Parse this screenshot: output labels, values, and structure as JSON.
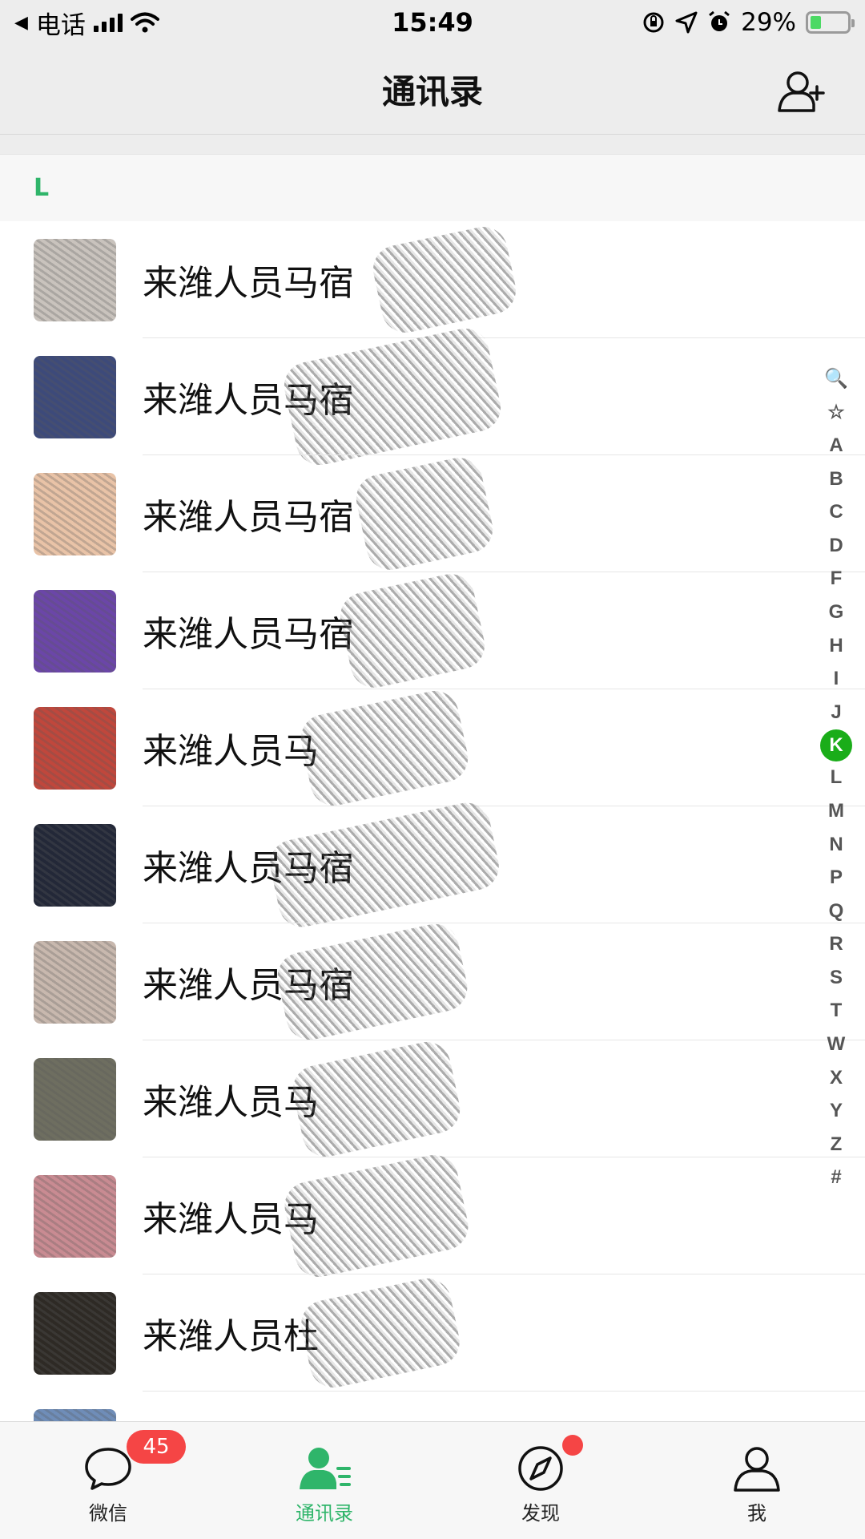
{
  "status_bar": {
    "back_label": "电话",
    "time": "15:49",
    "battery_percent": "29%",
    "battery_level": 0.29
  },
  "nav": {
    "title": "通讯录"
  },
  "section": {
    "letter": "L"
  },
  "contacts": [
    {
      "name": "来潍人员马宿",
      "avatar_color": "#c9c3bd"
    },
    {
      "name": "来潍人员马宿",
      "avatar_color": "#3d4a7a"
    },
    {
      "name": "来潍人员马宿",
      "avatar_color": "#e9c3a7"
    },
    {
      "name": "来潍人员马宿",
      "avatar_color": "#6b46a8"
    },
    {
      "name": "来潍人员马",
      "avatar_color": "#c0473c"
    },
    {
      "name": "来潍人员马宿",
      "avatar_color": "#232838"
    },
    {
      "name": "来潍人员马宿",
      "avatar_color": "#c8b8ae"
    },
    {
      "name": "来潍人员马",
      "avatar_color": "#6e6e60"
    },
    {
      "name": "来潍人员马",
      "avatar_color": "#c98b92"
    },
    {
      "name": "来潍人员杜",
      "avatar_color": "#2e2a25"
    },
    {
      "name": "",
      "avatar_color": "#6f8db8"
    }
  ],
  "index_bar": [
    "🔍",
    "☆",
    "A",
    "B",
    "C",
    "D",
    "F",
    "G",
    "H",
    "I",
    "J",
    "K",
    "L",
    "M",
    "N",
    "P",
    "Q",
    "R",
    "S",
    "T",
    "W",
    "X",
    "Y",
    "Z",
    "#"
  ],
  "index_active": "K",
  "tabs": [
    {
      "label": "微信",
      "icon": "chat-icon",
      "badge": "45"
    },
    {
      "label": "通讯录",
      "icon": "contacts-icon"
    },
    {
      "label": "发现",
      "icon": "compass-icon",
      "dot": true
    },
    {
      "label": "我",
      "icon": "person-icon"
    }
  ],
  "colors": {
    "accent": "#2fb56a",
    "badge": "#f54545",
    "active_index": "#1aad19"
  }
}
